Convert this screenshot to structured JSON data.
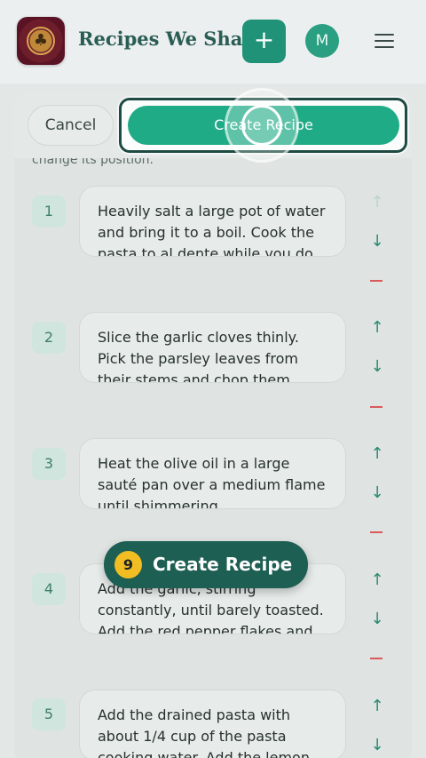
{
  "header": {
    "app_title": "Recipes We Share",
    "add_label": "+",
    "avatar_initial": "M",
    "logo_icon": "tree-emblem",
    "menu_icon": "hamburger-menu-icon"
  },
  "actions": {
    "cancel_label": "Cancel",
    "create_label": "Create Recipe",
    "hint_text": "change its position."
  },
  "steps": [
    {
      "number": "1",
      "text": "Heavily salt a large pot of water and bring it to a boil. Cook the pasta to al dente while you do"
    },
    {
      "number": "2",
      "text": "Slice the garlic cloves thinly. Pick the parsley leaves from their stems and chop them"
    },
    {
      "number": "3",
      "text": "Heat the olive oil in a large sauté pan over a medium flame until shimmering"
    },
    {
      "number": "4",
      "text": "Add the garlic, stirring constantly, until barely toasted. Add the red pepper flakes and"
    },
    {
      "number": "5",
      "text": "Add the drained pasta with about 1/4 cup of the pasta cooking water. Add the lemon"
    }
  ],
  "controls": {
    "move_up_symbol": "↑",
    "move_down_symbol": "↓"
  },
  "tour": {
    "step_number": "9",
    "label": "Create Recipe"
  },
  "colors": {
    "accent": "#1fab86",
    "tour_badge": "#1d5f53",
    "tour_number": "#f2bd23",
    "remove": "#d85a5a"
  }
}
